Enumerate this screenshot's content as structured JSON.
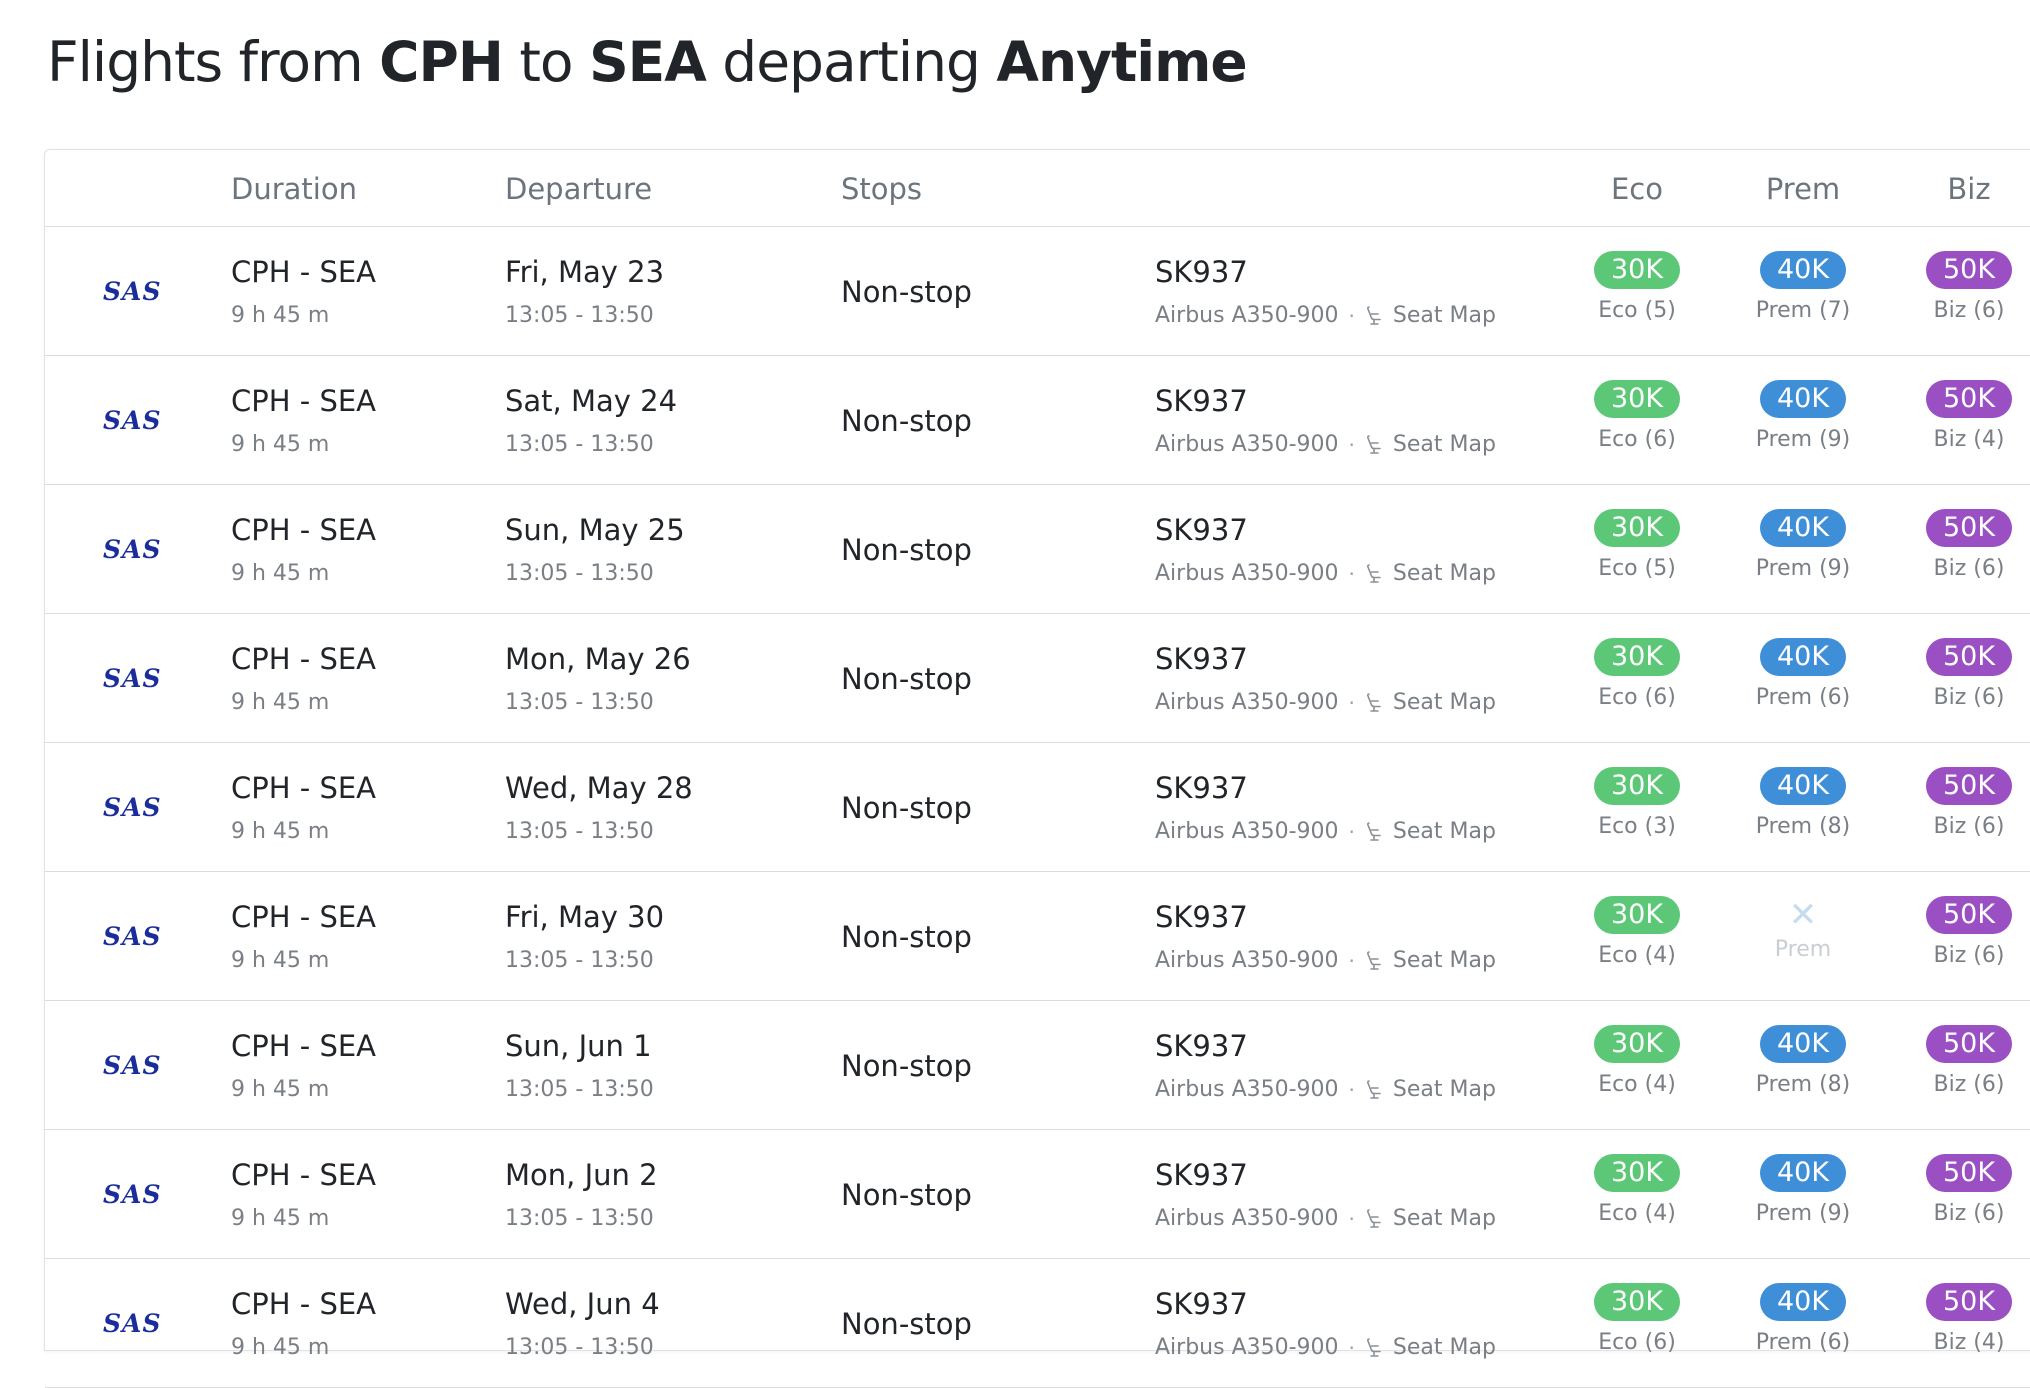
{
  "title": {
    "prefix": "Flights from ",
    "origin": "CPH",
    "to": " to ",
    "destination": "SEA",
    "departing": " departing ",
    "when": "Anytime"
  },
  "headers": {
    "duration": "Duration",
    "departure": "Departure",
    "stops": "Stops",
    "eco": "Eco",
    "prem": "Prem",
    "biz": "Biz"
  },
  "logo_text": "SAS",
  "seat_map_label": "Seat Map",
  "colors": {
    "eco": "#5cc877",
    "prem": "#3f8fd8",
    "biz": "#9a4fc2",
    "logo": "#1a2d9b"
  },
  "rows": [
    {
      "route": "CPH - SEA",
      "duration": "9 h 45 m",
      "date": "Fri, May 23",
      "time": "13:05 - 13:50",
      "stops": "Non-stop",
      "flight": "SK937",
      "aircraft": "Airbus A350-900",
      "eco": {
        "points": "30K",
        "seats": "Eco (5)"
      },
      "prem": {
        "points": "40K",
        "seats": "Prem (7)"
      },
      "biz": {
        "points": "50K",
        "seats": "Biz (6)"
      }
    },
    {
      "route": "CPH - SEA",
      "duration": "9 h 45 m",
      "date": "Sat, May 24",
      "time": "13:05 - 13:50",
      "stops": "Non-stop",
      "flight": "SK937",
      "aircraft": "Airbus A350-900",
      "eco": {
        "points": "30K",
        "seats": "Eco (6)"
      },
      "prem": {
        "points": "40K",
        "seats": "Prem (9)"
      },
      "biz": {
        "points": "50K",
        "seats": "Biz (4)"
      }
    },
    {
      "route": "CPH - SEA",
      "duration": "9 h 45 m",
      "date": "Sun, May 25",
      "time": "13:05 - 13:50",
      "stops": "Non-stop",
      "flight": "SK937",
      "aircraft": "Airbus A350-900",
      "eco": {
        "points": "30K",
        "seats": "Eco (5)"
      },
      "prem": {
        "points": "40K",
        "seats": "Prem (9)"
      },
      "biz": {
        "points": "50K",
        "seats": "Biz (6)"
      }
    },
    {
      "route": "CPH - SEA",
      "duration": "9 h 45 m",
      "date": "Mon, May 26",
      "time": "13:05 - 13:50",
      "stops": "Non-stop",
      "flight": "SK937",
      "aircraft": "Airbus A350-900",
      "eco": {
        "points": "30K",
        "seats": "Eco (6)"
      },
      "prem": {
        "points": "40K",
        "seats": "Prem (6)"
      },
      "biz": {
        "points": "50K",
        "seats": "Biz (6)"
      }
    },
    {
      "route": "CPH - SEA",
      "duration": "9 h 45 m",
      "date": "Wed, May 28",
      "time": "13:05 - 13:50",
      "stops": "Non-stop",
      "flight": "SK937",
      "aircraft": "Airbus A350-900",
      "eco": {
        "points": "30K",
        "seats": "Eco (3)"
      },
      "prem": {
        "points": "40K",
        "seats": "Prem (8)"
      },
      "biz": {
        "points": "50K",
        "seats": "Biz (6)"
      }
    },
    {
      "route": "CPH - SEA",
      "duration": "9 h 45 m",
      "date": "Fri, May 30",
      "time": "13:05 - 13:50",
      "stops": "Non-stop",
      "flight": "SK937",
      "aircraft": "Airbus A350-900",
      "eco": {
        "points": "30K",
        "seats": "Eco (4)"
      },
      "prem": {
        "unavailable": true,
        "mark": "✕",
        "label": "Prem"
      },
      "biz": {
        "points": "50K",
        "seats": "Biz (6)"
      }
    },
    {
      "route": "CPH - SEA",
      "duration": "9 h 45 m",
      "date": "Sun, Jun 1",
      "time": "13:05 - 13:50",
      "stops": "Non-stop",
      "flight": "SK937",
      "aircraft": "Airbus A350-900",
      "eco": {
        "points": "30K",
        "seats": "Eco (4)"
      },
      "prem": {
        "points": "40K",
        "seats": "Prem (8)"
      },
      "biz": {
        "points": "50K",
        "seats": "Biz (6)"
      }
    },
    {
      "route": "CPH - SEA",
      "duration": "9 h 45 m",
      "date": "Mon, Jun 2",
      "time": "13:05 - 13:50",
      "stops": "Non-stop",
      "flight": "SK937",
      "aircraft": "Airbus A350-900",
      "eco": {
        "points": "30K",
        "seats": "Eco (4)"
      },
      "prem": {
        "points": "40K",
        "seats": "Prem (9)"
      },
      "biz": {
        "points": "50K",
        "seats": "Biz (6)"
      }
    },
    {
      "route": "CPH - SEA",
      "duration": "9 h 45 m",
      "date": "Wed, Jun 4",
      "time": "13:05 - 13:50",
      "stops": "Non-stop",
      "flight": "SK937",
      "aircraft": "Airbus A350-900",
      "eco": {
        "points": "30K",
        "seats": "Eco (6)"
      },
      "prem": {
        "points": "40K",
        "seats": "Prem (6)"
      },
      "biz": {
        "points": "50K",
        "seats": "Biz (4)"
      }
    }
  ]
}
